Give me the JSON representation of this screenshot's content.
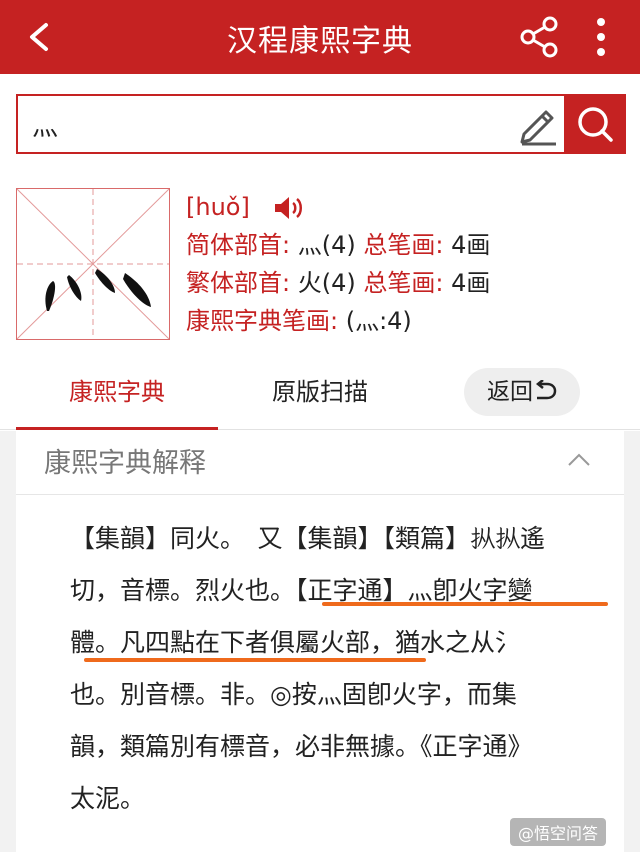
{
  "app": {
    "title": "汉程康熙字典"
  },
  "search": {
    "value": "灬"
  },
  "character": {
    "pinyin": "[huǒ]",
    "simplified_radical_label": "简体部首: ",
    "simplified_radical_value": "灬(4)",
    "simplified_strokes_label": " 总笔画: ",
    "simplified_strokes_value": "4画",
    "traditional_radical_label": "繁体部首: ",
    "traditional_radical_value": "火(4)",
    "traditional_strokes_label": " 总笔画: ",
    "traditional_strokes_value": "4画",
    "kangxi_strokes_label": "康熙字典笔画: ",
    "kangxi_strokes_value": "(灬:4)"
  },
  "tabs": [
    {
      "label": "康熙字典"
    },
    {
      "label": "原版扫描"
    }
  ],
  "return_button": {
    "label": "返回"
  },
  "panel": {
    "title": "康熙字典解释",
    "lines": [
      "【集韻】同火。　又【集韻】【類篇】𪭢𪭢遙",
      "切，音標。烈火也。【正字通】灬卽火字變",
      "體。凡四點在下者俱屬火部，猶水之从氵",
      "也。別音標。非。◎按灬固卽火字，而集",
      "韻，類篇別有標音，必非無據。《正字通》",
      "太泥。"
    ]
  },
  "watermark": {
    "text": "@悟空问答"
  },
  "colors": {
    "brand_red": "#c52222",
    "underline_orange": "#ef6a1c"
  }
}
